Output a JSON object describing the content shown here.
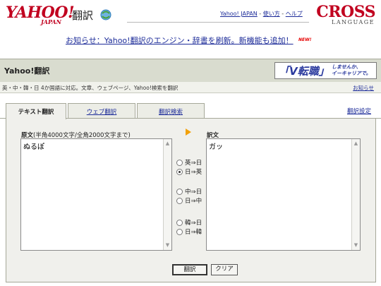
{
  "header": {
    "logo_main": "YAHOO!",
    "logo_sub": "JAPAN",
    "logo_trans": "翻訳",
    "links": [
      "Yahoo! JAPAN",
      "使い方",
      "ヘルプ"
    ],
    "link_sep": " - ",
    "cross_main": "CROSS",
    "cross_sub": "LANGUAGE"
  },
  "news": {
    "text": "お知らせ：Yahoo!翻訳のエンジン・辞書を刷新。新機能も追加！",
    "badge": "NEW!"
  },
  "titlebar": {
    "title": "Yahoo!翻訳",
    "banner_main": "「V転職」",
    "banner_line1": "しませんか、",
    "banner_line2": "イーキャリアで。"
  },
  "subbar": {
    "text": "英・中・韓・日 4か国語に対応。文章、ウェブページ、Yahoo!検索を翻訳",
    "link": "お知らせ"
  },
  "tabs": [
    {
      "label": "テキスト翻訳",
      "active": true
    },
    {
      "label": "ウェブ翻訳",
      "active": false
    },
    {
      "label": "翻訳検索",
      "active": false
    }
  ],
  "settings_link": "翻訳設定",
  "source": {
    "label_bold": "原文",
    "label_note": "(半角4000文字/全角2000文字まで)",
    "value": "ぬるぽ"
  },
  "target": {
    "label": "訳文",
    "value": "ガッ"
  },
  "directions": [
    {
      "label": "英⇒日",
      "checked": false
    },
    {
      "label": "日⇒英",
      "checked": true
    },
    {
      "label": "中⇒日",
      "checked": false
    },
    {
      "label": "日⇒中",
      "checked": false
    },
    {
      "label": "韓⇒日",
      "checked": false
    },
    {
      "label": "日⇒韓",
      "checked": false
    }
  ],
  "buttons": {
    "translate": "翻訳",
    "clear": "クリア"
  },
  "colors": {
    "brand_red": "#c1001f",
    "link_blue": "#1d2c99",
    "titlebar_bg": "#d9dccf",
    "arrow_orange": "#f2a10a"
  }
}
